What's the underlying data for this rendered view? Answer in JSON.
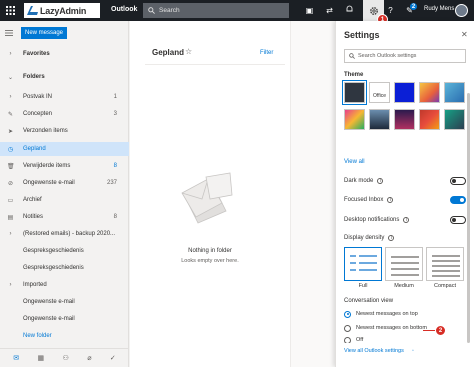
{
  "topbar": {
    "logo": "LazyAdmin",
    "app_name": "Outlook",
    "search_placeholder": "Search",
    "user_name": "Rudy Mens",
    "notification_count": "2",
    "callout_1": "1"
  },
  "sidebar": {
    "new_message_label": "New message",
    "favorites_label": "Favorites",
    "folders_label": "Folders",
    "items": [
      {
        "icon": "inbox-icon",
        "label": "Postvak IN",
        "count": "1"
      },
      {
        "icon": "pencil-icon",
        "label": "Concepten",
        "count": "3"
      },
      {
        "icon": "send-icon",
        "label": "Verzonden items",
        "count": ""
      },
      {
        "icon": "clock-icon",
        "label": "Gepland",
        "count": ""
      },
      {
        "icon": "trash-icon",
        "label": "Verwijderde items",
        "count": "8"
      },
      {
        "icon": "block-icon",
        "label": "Ongewenste e-mail",
        "count": "237"
      },
      {
        "icon": "archive-icon",
        "label": "Archief",
        "count": ""
      },
      {
        "icon": "note-icon",
        "label": "Notities",
        "count": "8"
      },
      {
        "icon": "chevron-right-icon",
        "label": "(Restored emails) - backup 2020...",
        "count": ""
      },
      {
        "icon": "",
        "label": "Gespreksgeschiedenis",
        "count": ""
      },
      {
        "icon": "",
        "label": "Gespreksgeschiedenis",
        "count": ""
      },
      {
        "icon": "chevron-right-icon",
        "label": "Imported",
        "count": ""
      },
      {
        "icon": "",
        "label": "Ongewenste e-mail",
        "count": ""
      },
      {
        "icon": "",
        "label": "Ongewenste e-mail",
        "count": ""
      }
    ],
    "new_folder_label": "New folder"
  },
  "message_list": {
    "title": "Gepland",
    "filter_label": "Filter",
    "empty_title": "Nothing in folder",
    "empty_subtitle": "Looks empty over here."
  },
  "settings": {
    "title": "Settings",
    "search_placeholder": "Search Outlook settings",
    "theme_heading": "Theme",
    "theme_office_label": "Office",
    "view_all_label": "View all",
    "dark_mode_label": "Dark mode",
    "focused_inbox_label": "Focused Inbox",
    "desktop_notifications_label": "Desktop notifications",
    "display_density_label": "Display density",
    "density_options": [
      "Full",
      "Medium",
      "Compact"
    ],
    "conversation_view_label": "Conversation view",
    "conversation_options": [
      "Newest messages on top",
      "Newest messages on bottom",
      "Off"
    ],
    "view_all_outlook_label": "View all Outlook settings",
    "callout_2": "2",
    "toggles": {
      "dark_mode": false,
      "focused_inbox": true,
      "desktop_notifications": false
    }
  },
  "colors": {
    "accent": "#0078d4",
    "topbar": "#1b1f24",
    "callout": "#d72d25"
  }
}
